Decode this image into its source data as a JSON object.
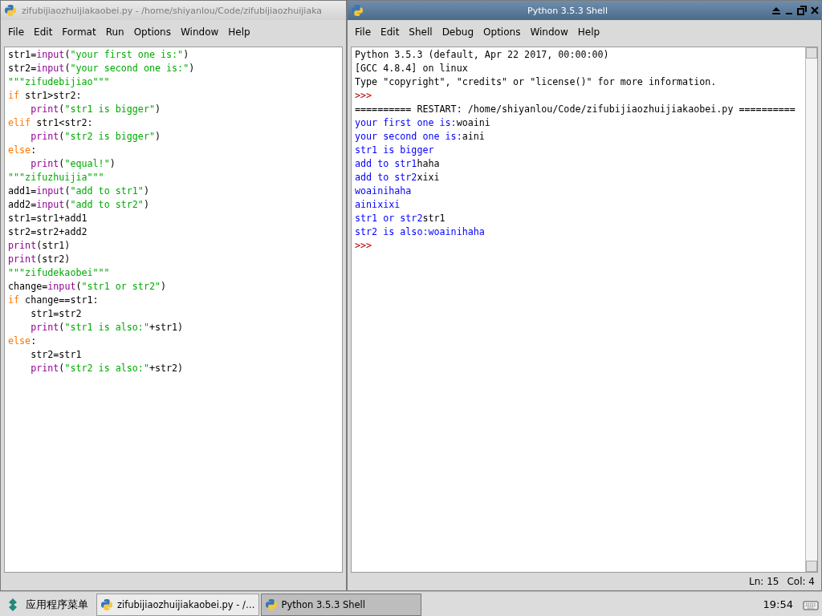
{
  "editor_window": {
    "title": "zifubijiaozhuijiakaobei.py - /home/shiyanlou/Code/zifubijiaozhuijiaka",
    "active": false,
    "menu": [
      "File",
      "Edit",
      "Format",
      "Run",
      "Options",
      "Window",
      "Help"
    ],
    "lines": [
      [
        {
          "kind": "plain",
          "text": "str1="
        },
        {
          "kind": "builtin",
          "text": "input"
        },
        {
          "kind": "plain",
          "text": "("
        },
        {
          "kind": "string",
          "text": "\"your first one is:\""
        },
        {
          "kind": "plain",
          "text": ")"
        }
      ],
      [
        {
          "kind": "plain",
          "text": "str2="
        },
        {
          "kind": "builtin",
          "text": "input"
        },
        {
          "kind": "plain",
          "text": "("
        },
        {
          "kind": "string",
          "text": "\"your second one is:\""
        },
        {
          "kind": "plain",
          "text": ")"
        }
      ],
      [
        {
          "kind": "string",
          "text": "\"\"\"zifudebijiao\"\"\""
        }
      ],
      [
        {
          "kind": "keyword",
          "text": "if"
        },
        {
          "kind": "plain",
          "text": " str1>str2:"
        }
      ],
      [
        {
          "kind": "indent"
        },
        {
          "kind": "builtin",
          "text": "print"
        },
        {
          "kind": "plain",
          "text": "("
        },
        {
          "kind": "string",
          "text": "\"str1 is bigger\""
        },
        {
          "kind": "plain",
          "text": ")"
        }
      ],
      [
        {
          "kind": "keyword",
          "text": "elif"
        },
        {
          "kind": "plain",
          "text": " str1<str2:"
        }
      ],
      [
        {
          "kind": "indent"
        },
        {
          "kind": "builtin",
          "text": "print"
        },
        {
          "kind": "plain",
          "text": "("
        },
        {
          "kind": "string",
          "text": "\"str2 is bigger\""
        },
        {
          "kind": "plain",
          "text": ")"
        }
      ],
      [
        {
          "kind": "keyword",
          "text": "else"
        },
        {
          "kind": "plain",
          "text": ":"
        }
      ],
      [
        {
          "kind": "indent"
        },
        {
          "kind": "builtin",
          "text": "print"
        },
        {
          "kind": "plain",
          "text": "("
        },
        {
          "kind": "string",
          "text": "\"equal!\""
        },
        {
          "kind": "plain",
          "text": ")"
        }
      ],
      [
        {
          "kind": "string",
          "text": "\"\"\"zifuzhuijia\"\"\""
        }
      ],
      [
        {
          "kind": "plain",
          "text": "add1="
        },
        {
          "kind": "builtin",
          "text": "input"
        },
        {
          "kind": "plain",
          "text": "("
        },
        {
          "kind": "string",
          "text": "\"add to str1\""
        },
        {
          "kind": "plain",
          "text": ")"
        }
      ],
      [
        {
          "kind": "plain",
          "text": "add2="
        },
        {
          "kind": "builtin",
          "text": "input"
        },
        {
          "kind": "plain",
          "text": "("
        },
        {
          "kind": "string",
          "text": "\"add to str2\""
        },
        {
          "kind": "plain",
          "text": ")"
        }
      ],
      [
        {
          "kind": "plain",
          "text": "str1=str1+add1"
        }
      ],
      [
        {
          "kind": "plain",
          "text": "str2=str2+add2"
        }
      ],
      [
        {
          "kind": "builtin",
          "text": "print"
        },
        {
          "kind": "plain",
          "text": "(str1)"
        }
      ],
      [
        {
          "kind": "builtin",
          "text": "print"
        },
        {
          "kind": "plain",
          "text": "(str2)"
        }
      ],
      [
        {
          "kind": "string",
          "text": "\"\"\"zifudekaobei\"\"\""
        }
      ],
      [
        {
          "kind": "plain",
          "text": "change="
        },
        {
          "kind": "builtin",
          "text": "input"
        },
        {
          "kind": "plain",
          "text": "("
        },
        {
          "kind": "string",
          "text": "\"str1 or str2\""
        },
        {
          "kind": "plain",
          "text": ")"
        }
      ],
      [
        {
          "kind": "keyword",
          "text": "if"
        },
        {
          "kind": "plain",
          "text": " change==str1:"
        }
      ],
      [
        {
          "kind": "indent"
        },
        {
          "kind": "plain",
          "text": "str1=str2"
        }
      ],
      [
        {
          "kind": "indent"
        },
        {
          "kind": "builtin",
          "text": "print"
        },
        {
          "kind": "plain",
          "text": "("
        },
        {
          "kind": "string",
          "text": "\"str1 is also:\""
        },
        {
          "kind": "plain",
          "text": "+str1)"
        }
      ],
      [
        {
          "kind": "keyword",
          "text": "else"
        },
        {
          "kind": "plain",
          "text": ":"
        }
      ],
      [
        {
          "kind": "indent"
        },
        {
          "kind": "plain",
          "text": "str2=str1"
        }
      ],
      [
        {
          "kind": "indent"
        },
        {
          "kind": "builtin",
          "text": "print"
        },
        {
          "kind": "plain",
          "text": "("
        },
        {
          "kind": "string",
          "text": "\"str2 is also:\""
        },
        {
          "kind": "plain",
          "text": "+str2)"
        }
      ]
    ]
  },
  "shell_window": {
    "title": "Python 3.5.3 Shell",
    "active": true,
    "menu": [
      "File",
      "Edit",
      "Shell",
      "Debug",
      "Options",
      "Window",
      "Help"
    ],
    "lines": [
      [
        {
          "kind": "plain",
          "text": "Python 3.5.3 (default, Apr 22 2017, 00:00:00)"
        }
      ],
      [
        {
          "kind": "plain",
          "text": "[GCC 4.8.4] on linux"
        }
      ],
      [
        {
          "kind": "plain",
          "text": "Type \"copyright\", \"credits\" or \"license()\" for more information."
        }
      ],
      [
        {
          "kind": "prompt",
          "text": ">>>"
        }
      ],
      [
        {
          "kind": "plain",
          "text": "========== RESTART: /home/shiyanlou/Code/zifubijiaozhuijiakaobei.py =========="
        }
      ],
      [
        {
          "kind": "stdout",
          "text": "your first one is:"
        },
        {
          "kind": "plain",
          "text": "woaini"
        }
      ],
      [
        {
          "kind": "stdout",
          "text": "your second one is:"
        },
        {
          "kind": "plain",
          "text": "aini"
        }
      ],
      [
        {
          "kind": "stdout",
          "text": "str1 is bigger"
        }
      ],
      [
        {
          "kind": "stdout",
          "text": "add to str1"
        },
        {
          "kind": "plain",
          "text": "haha"
        }
      ],
      [
        {
          "kind": "stdout",
          "text": "add to str2"
        },
        {
          "kind": "plain",
          "text": "xixi"
        }
      ],
      [
        {
          "kind": "stdout",
          "text": "woainihaha"
        }
      ],
      [
        {
          "kind": "stdout",
          "text": "ainixixi"
        }
      ],
      [
        {
          "kind": "stdout",
          "text": "str1 or str2"
        },
        {
          "kind": "plain",
          "text": "str1"
        }
      ],
      [
        {
          "kind": "stdout",
          "text": "str2 is also:woainihaha"
        }
      ],
      [
        {
          "kind": "prompt",
          "text": ">>>"
        }
      ]
    ],
    "status": {
      "line": "Ln: 15",
      "column": "Col: 4"
    }
  },
  "taskbar": {
    "start_label": "应用程序菜单",
    "tasks": [
      {
        "label": "zifubijiaozhuijiakaobei.py - /…",
        "selected": false
      },
      {
        "label": "Python 3.5.3 Shell",
        "selected": true
      }
    ],
    "clock": "19:54"
  }
}
